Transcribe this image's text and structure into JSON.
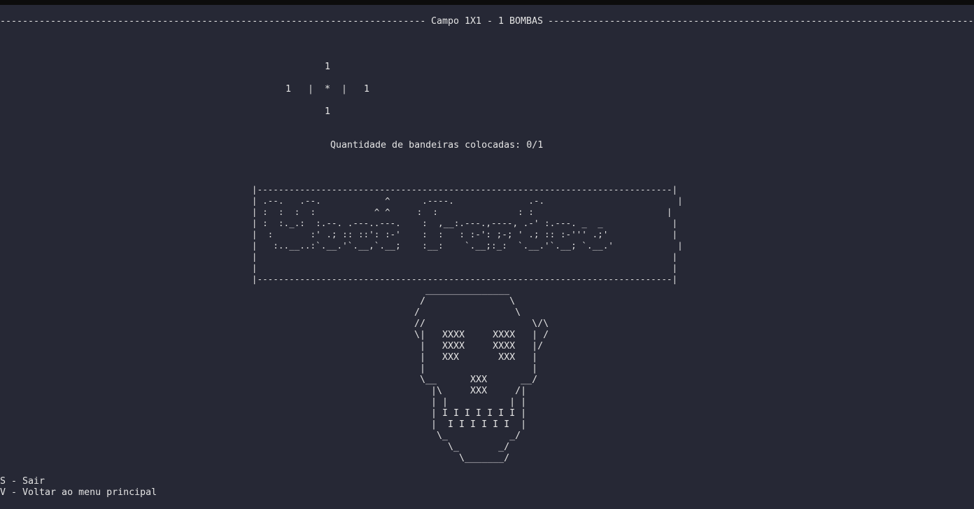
{
  "topbar": {
    "status_text": "_ . , _ , _ , . , . . _ , . _ _ , . . _ , . . _ . _ ,"
  },
  "header": {
    "title": "Campo 1X1 - 1 BOMBAS"
  },
  "board": {
    "top": "1",
    "left": "1",
    "center": "*",
    "right": "1",
    "bottom": "1",
    "separator": "|"
  },
  "flags": {
    "label": "Quantidade de bandeiras colocadas: 0/1"
  },
  "banner": {
    "art": "|------------------------------------------------------------------------------|\n| .--.   .--.            ^      .----.              .-.                         |\n| :  :  :  :           ^ ^     :  :               : :                         |\n| :  :._.:  :.--. .---..---.    :  ,__:.---.,----, .-' :.---. _  _             |\n|  :       :' .; :: ::': :-'    :  :   : :-': ;-; ' .; :: :-''' .;'            |\n|   :..__..:`.__.'`.__,`.__;    :__:    `.__;:_:  `.__.'`.__; `.__.'            |\n|                                                                              |\n|                                                                              |\n|------------------------------------------------------------------------------|"
  },
  "skull": {
    "art": "  _______________\n /               \\\n/                 \\\n//                   \\/\\\n\\|   XXXX     XXXX   | /\n |   XXXX     XXXX   |/\n |   XXX       XXX   |\n |                   |\n \\__      XXX      __/\n   |\\     XXX     /|\n   | |           | |\n   | I I I I I I I |\n   |  I I I I I I  |\n    \\_           _/\n      \\_       _/\n        \\_______/"
  },
  "menu": {
    "quit": "S - Sair",
    "back": "V - Voltar ao menu principal"
  }
}
